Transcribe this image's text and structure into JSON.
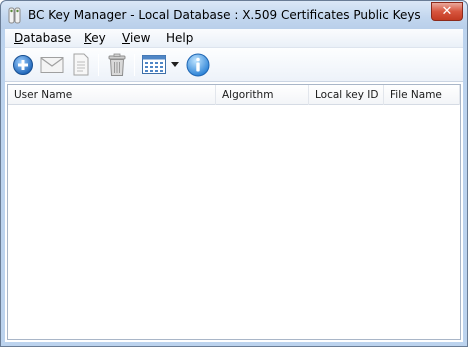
{
  "window": {
    "title": "BC Key Manager - Local Database : X.509 Certificates Public Keys",
    "close_label": "✕"
  },
  "menu": {
    "database": {
      "underlined": "D",
      "rest": "atabase"
    },
    "key": {
      "underlined": "K",
      "rest": "ey"
    },
    "view": {
      "underlined": "V",
      "rest": "iew"
    },
    "help": {
      "underlined": "",
      "rest": "Help"
    }
  },
  "toolbar": {
    "icons": [
      "add-icon",
      "mail-icon",
      "document-icon",
      "trash-icon",
      "list-view-icon",
      "dropdown-arrow-icon",
      "info-icon"
    ]
  },
  "list": {
    "columns": [
      "User Name",
      "Algorithm",
      "Local key ID",
      "File Name"
    ],
    "rows": []
  },
  "colors": {
    "title_bar": "#c2d6ee",
    "close_button": "#d7553e",
    "accent_blue": "#2f7fd0"
  }
}
